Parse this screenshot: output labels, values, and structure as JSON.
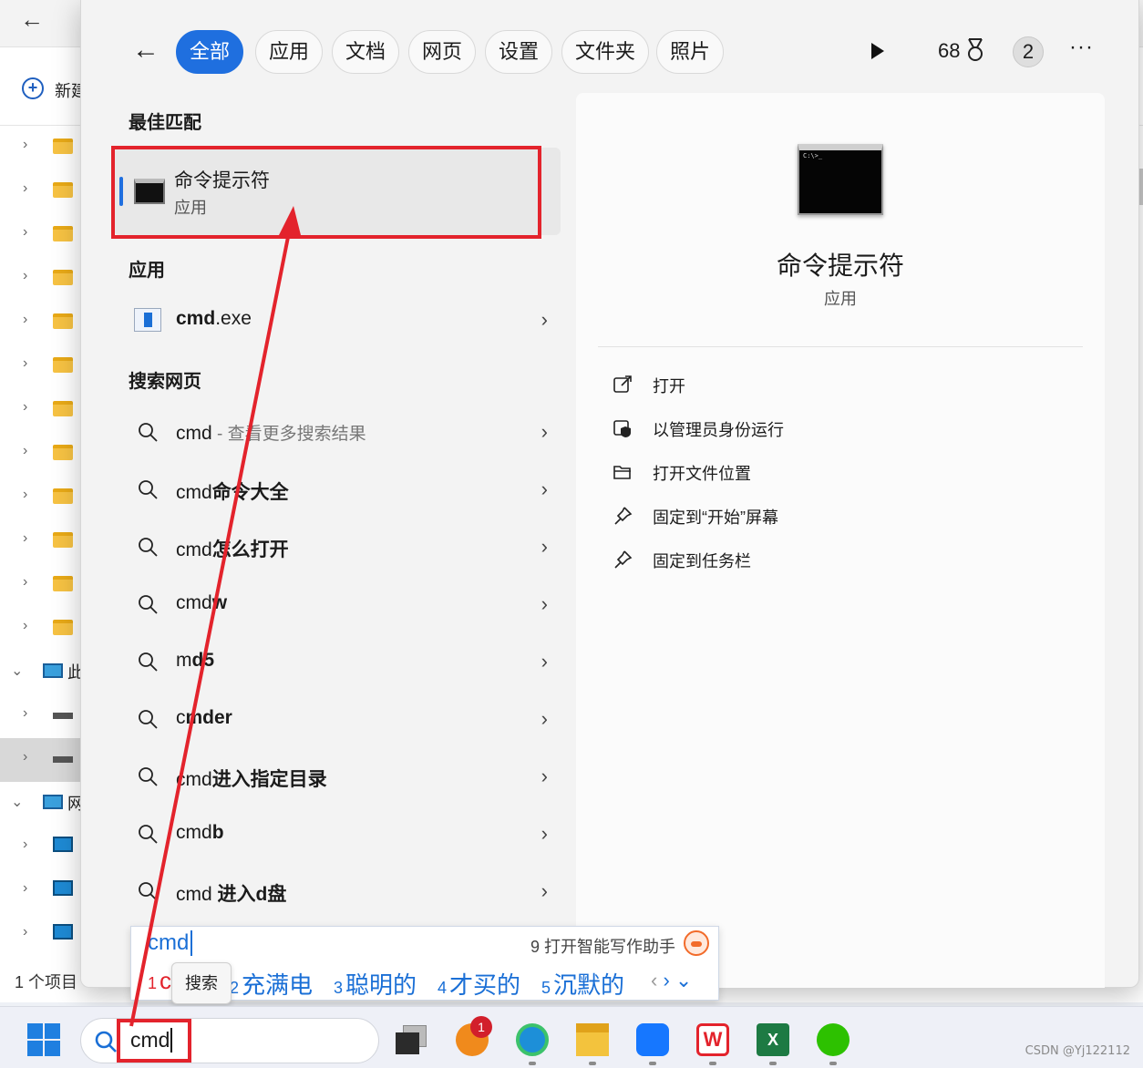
{
  "explorer": {
    "new_label": "新建",
    "status": "1 个项目",
    "pc_label": "此",
    "net_label": "网"
  },
  "tabs": [
    "全部",
    "应用",
    "文档",
    "网页",
    "设置",
    "文件夹",
    "照片"
  ],
  "header": {
    "points": "68",
    "count": "2",
    "more": "···"
  },
  "sections": {
    "best": "最佳匹配",
    "apps": "应用",
    "web": "搜索网页"
  },
  "best_match": {
    "title": "命令提示符",
    "subtitle": "应用"
  },
  "app_result": {
    "name_bold": "cmd",
    "name_rest": ".exe"
  },
  "web_results": [
    {
      "prefix": "cmd",
      "bold": "",
      "hint": " - 查看更多搜索结果"
    },
    {
      "prefix": "cmd",
      "bold": "命令大全",
      "hint": ""
    },
    {
      "prefix": "cmd",
      "bold": "怎么打开",
      "hint": ""
    },
    {
      "prefix": "cmd",
      "bold": "w",
      "hint": ""
    },
    {
      "prefix": "m",
      "bold": "d5",
      "hint": ""
    },
    {
      "prefix": "c",
      "bold": "mder",
      "hint": ""
    },
    {
      "prefix": "cmd",
      "bold": "进入指定目录",
      "hint": ""
    },
    {
      "prefix": "cmd",
      "bold": "b",
      "hint": ""
    },
    {
      "prefix": "cmd ",
      "bold": "进入d盘",
      "hint": ""
    }
  ],
  "detail": {
    "title": "命令提示符",
    "subtitle": "应用",
    "actions": [
      "打开",
      "以管理员身份运行",
      "打开文件位置",
      "固定到“开始”屏幕",
      "固定到任务栏"
    ]
  },
  "ime": {
    "input": "cmd",
    "assist": "9 打开智能写作助手",
    "candidates": [
      {
        "n": "1",
        "text": "c"
      },
      {
        "n": "2",
        "text": "充满电"
      },
      {
        "n": "3",
        "text": "聪明的"
      },
      {
        "n": "4",
        "text": "才买的"
      },
      {
        "n": "5",
        "text": "沉默的"
      }
    ],
    "tooltip": "搜索"
  },
  "taskbar": {
    "search_text": "cmd",
    "notification_badge": "1"
  },
  "watermark": "CSDN @Yj122112",
  "colors": {
    "accent": "#1f6fdf",
    "annotation_red": "#e3232c"
  }
}
